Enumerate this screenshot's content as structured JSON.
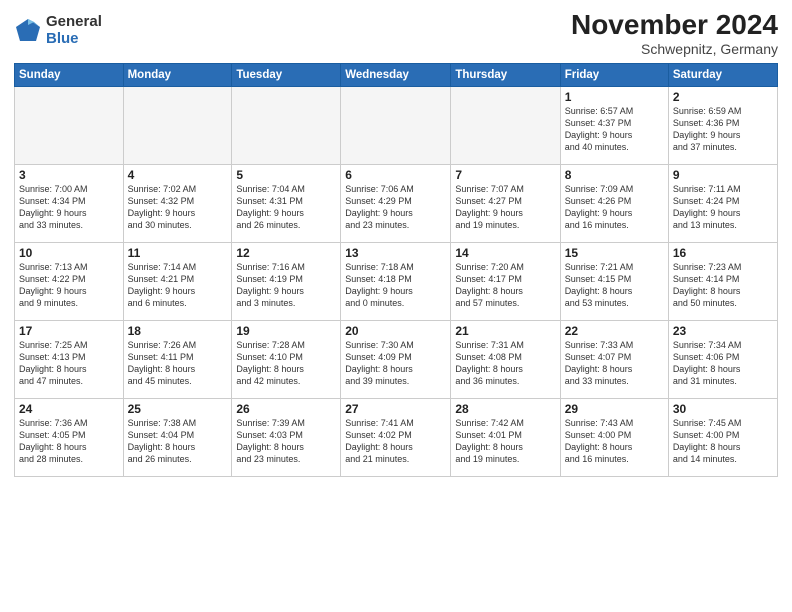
{
  "logo": {
    "general": "General",
    "blue": "Blue"
  },
  "title": "November 2024",
  "subtitle": "Schwepnitz, Germany",
  "headers": [
    "Sunday",
    "Monday",
    "Tuesday",
    "Wednesday",
    "Thursday",
    "Friday",
    "Saturday"
  ],
  "weeks": [
    [
      {
        "day": "",
        "info": ""
      },
      {
        "day": "",
        "info": ""
      },
      {
        "day": "",
        "info": ""
      },
      {
        "day": "",
        "info": ""
      },
      {
        "day": "",
        "info": ""
      },
      {
        "day": "1",
        "info": "Sunrise: 6:57 AM\nSunset: 4:37 PM\nDaylight: 9 hours\nand 40 minutes."
      },
      {
        "day": "2",
        "info": "Sunrise: 6:59 AM\nSunset: 4:36 PM\nDaylight: 9 hours\nand 37 minutes."
      }
    ],
    [
      {
        "day": "3",
        "info": "Sunrise: 7:00 AM\nSunset: 4:34 PM\nDaylight: 9 hours\nand 33 minutes."
      },
      {
        "day": "4",
        "info": "Sunrise: 7:02 AM\nSunset: 4:32 PM\nDaylight: 9 hours\nand 30 minutes."
      },
      {
        "day": "5",
        "info": "Sunrise: 7:04 AM\nSunset: 4:31 PM\nDaylight: 9 hours\nand 26 minutes."
      },
      {
        "day": "6",
        "info": "Sunrise: 7:06 AM\nSunset: 4:29 PM\nDaylight: 9 hours\nand 23 minutes."
      },
      {
        "day": "7",
        "info": "Sunrise: 7:07 AM\nSunset: 4:27 PM\nDaylight: 9 hours\nand 19 minutes."
      },
      {
        "day": "8",
        "info": "Sunrise: 7:09 AM\nSunset: 4:26 PM\nDaylight: 9 hours\nand 16 minutes."
      },
      {
        "day": "9",
        "info": "Sunrise: 7:11 AM\nSunset: 4:24 PM\nDaylight: 9 hours\nand 13 minutes."
      }
    ],
    [
      {
        "day": "10",
        "info": "Sunrise: 7:13 AM\nSunset: 4:22 PM\nDaylight: 9 hours\nand 9 minutes."
      },
      {
        "day": "11",
        "info": "Sunrise: 7:14 AM\nSunset: 4:21 PM\nDaylight: 9 hours\nand 6 minutes."
      },
      {
        "day": "12",
        "info": "Sunrise: 7:16 AM\nSunset: 4:19 PM\nDaylight: 9 hours\nand 3 minutes."
      },
      {
        "day": "13",
        "info": "Sunrise: 7:18 AM\nSunset: 4:18 PM\nDaylight: 9 hours\nand 0 minutes."
      },
      {
        "day": "14",
        "info": "Sunrise: 7:20 AM\nSunset: 4:17 PM\nDaylight: 8 hours\nand 57 minutes."
      },
      {
        "day": "15",
        "info": "Sunrise: 7:21 AM\nSunset: 4:15 PM\nDaylight: 8 hours\nand 53 minutes."
      },
      {
        "day": "16",
        "info": "Sunrise: 7:23 AM\nSunset: 4:14 PM\nDaylight: 8 hours\nand 50 minutes."
      }
    ],
    [
      {
        "day": "17",
        "info": "Sunrise: 7:25 AM\nSunset: 4:13 PM\nDaylight: 8 hours\nand 47 minutes."
      },
      {
        "day": "18",
        "info": "Sunrise: 7:26 AM\nSunset: 4:11 PM\nDaylight: 8 hours\nand 45 minutes."
      },
      {
        "day": "19",
        "info": "Sunrise: 7:28 AM\nSunset: 4:10 PM\nDaylight: 8 hours\nand 42 minutes."
      },
      {
        "day": "20",
        "info": "Sunrise: 7:30 AM\nSunset: 4:09 PM\nDaylight: 8 hours\nand 39 minutes."
      },
      {
        "day": "21",
        "info": "Sunrise: 7:31 AM\nSunset: 4:08 PM\nDaylight: 8 hours\nand 36 minutes."
      },
      {
        "day": "22",
        "info": "Sunrise: 7:33 AM\nSunset: 4:07 PM\nDaylight: 8 hours\nand 33 minutes."
      },
      {
        "day": "23",
        "info": "Sunrise: 7:34 AM\nSunset: 4:06 PM\nDaylight: 8 hours\nand 31 minutes."
      }
    ],
    [
      {
        "day": "24",
        "info": "Sunrise: 7:36 AM\nSunset: 4:05 PM\nDaylight: 8 hours\nand 28 minutes."
      },
      {
        "day": "25",
        "info": "Sunrise: 7:38 AM\nSunset: 4:04 PM\nDaylight: 8 hours\nand 26 minutes."
      },
      {
        "day": "26",
        "info": "Sunrise: 7:39 AM\nSunset: 4:03 PM\nDaylight: 8 hours\nand 23 minutes."
      },
      {
        "day": "27",
        "info": "Sunrise: 7:41 AM\nSunset: 4:02 PM\nDaylight: 8 hours\nand 21 minutes."
      },
      {
        "day": "28",
        "info": "Sunrise: 7:42 AM\nSunset: 4:01 PM\nDaylight: 8 hours\nand 19 minutes."
      },
      {
        "day": "29",
        "info": "Sunrise: 7:43 AM\nSunset: 4:00 PM\nDaylight: 8 hours\nand 16 minutes."
      },
      {
        "day": "30",
        "info": "Sunrise: 7:45 AM\nSunset: 4:00 PM\nDaylight: 8 hours\nand 14 minutes."
      }
    ]
  ]
}
